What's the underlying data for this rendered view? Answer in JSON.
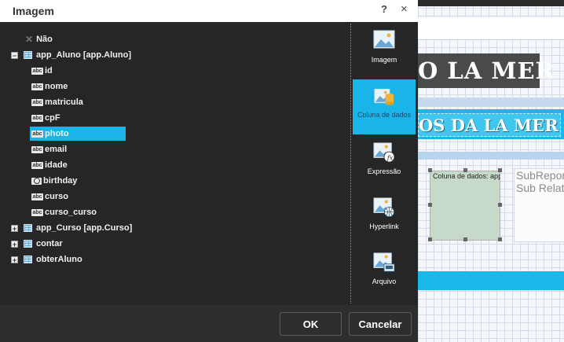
{
  "dialog": {
    "title": "Imagem",
    "help_label": "?",
    "close_label": "×",
    "ok_label": "OK",
    "cancel_label": "Cancelar"
  },
  "tree": {
    "none_label": "Não",
    "app_aluno": {
      "label": "app_Aluno [app.Aluno]",
      "fields": [
        {
          "name": "id",
          "icon": "abc"
        },
        {
          "name": "nome",
          "icon": "abc"
        },
        {
          "name": "matricula",
          "icon": "abc"
        },
        {
          "name": "cpF",
          "icon": "abc"
        },
        {
          "name": "photo",
          "icon": "abc",
          "selected": true
        },
        {
          "name": "email",
          "icon": "abc"
        },
        {
          "name": "idade",
          "icon": "abc"
        },
        {
          "name": "birthday",
          "icon": "clock"
        },
        {
          "name": "curso",
          "icon": "abc"
        },
        {
          "name": "curso_curso",
          "icon": "abc"
        }
      ]
    },
    "collapsed": [
      "app_Curso [app.Curso]",
      "contar",
      "obterAluno"
    ],
    "abc_icon_text": "abc"
  },
  "sidebar": [
    {
      "label": "Imagem",
      "icon": "image-icon"
    },
    {
      "label": "Coluna de dados",
      "icon": "data-column-icon",
      "active": true
    },
    {
      "label": "Expressão",
      "icon": "expression-icon"
    },
    {
      "label": "Hyperlink",
      "icon": "hyperlink-icon"
    },
    {
      "label": "Arquivo",
      "icon": "file-icon"
    }
  ],
  "background": {
    "title_text": "O LA MER",
    "subtitle_text": "OS DA LA MER",
    "image_box_label": "Coluna de dados: app",
    "subreport_lines": [
      "SubRepor",
      "Sub Relat"
    ]
  },
  "colors": {
    "accent": "#1ab4e8",
    "dialog_bg": "#262626"
  }
}
